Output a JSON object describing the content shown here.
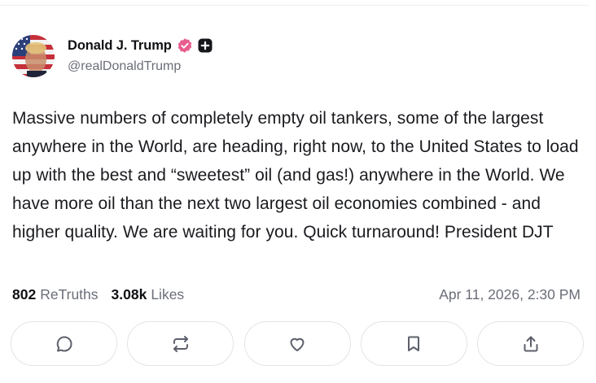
{
  "author": {
    "display_name": "Donald J. Trump",
    "handle": "@realDonaldTrump",
    "avatar_icon": "flag-portrait-avatar",
    "verified_icon": "verified-badge-icon",
    "verified_color": "#e85d8e",
    "plus_icon": "plus-badge-icon"
  },
  "post": {
    "text": "Massive numbers of completely empty oil tankers, some of the largest anywhere in the World, are heading, right now, to the United States to load up with the best and “sweetest” oil (and gas!) anywhere in the World. We have more oil than the next two largest oil economies combined - and higher quality. We are waiting for you. Quick turnaround! President DJT"
  },
  "stats": {
    "retruths_count": "802",
    "retruths_label": "ReTruths",
    "likes_count": "3.08k",
    "likes_label": "Likes",
    "timestamp": "Apr 11, 2026, 2:30 PM"
  },
  "actions": [
    {
      "name": "reply-button",
      "icon": "reply-icon"
    },
    {
      "name": "retruth-button",
      "icon": "retruth-icon"
    },
    {
      "name": "like-button",
      "icon": "heart-icon"
    },
    {
      "name": "bookmark-button",
      "icon": "bookmark-icon"
    },
    {
      "name": "share-button",
      "icon": "share-icon"
    }
  ],
  "colors": {
    "text_primary": "#101114",
    "text_secondary": "#6b6e78",
    "border": "#e3e4e8"
  }
}
